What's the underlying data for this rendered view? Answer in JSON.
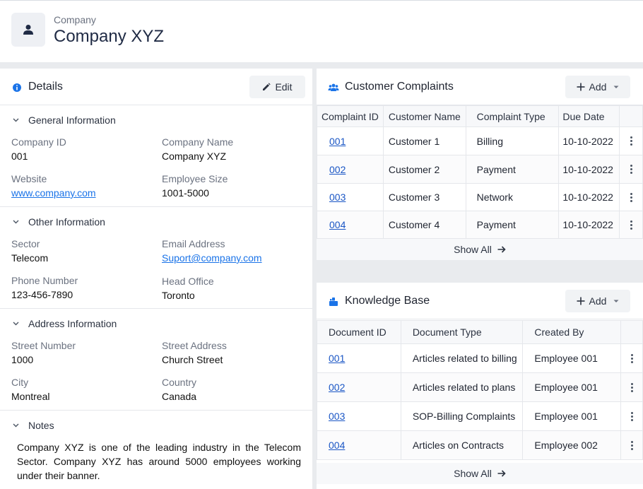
{
  "header": {
    "subtitle": "Company",
    "title": "Company XYZ"
  },
  "details": {
    "title": "Details",
    "edit_label": "Edit",
    "sections": {
      "general": {
        "title": "General Information",
        "company_id_label": "Company ID",
        "company_id": "001",
        "company_name_label": "Company Name",
        "company_name": "Company XYZ",
        "website_label": "Website",
        "website": "www.company.com",
        "employee_size_label": "Employee Size",
        "employee_size": "1001-5000"
      },
      "other": {
        "title": "Other Information",
        "sector_label": "Sector",
        "sector": "Telecom",
        "email_label": "Email Address",
        "email": "Suport@company.com",
        "phone_label": "Phone Number",
        "phone": "123-456-7890",
        "head_office_label": "Head Office",
        "head_office": "Toronto"
      },
      "address": {
        "title": "Address Information",
        "street_number_label": "Street Number",
        "street_number": "1000",
        "street_address_label": "Street Address",
        "street_address": "Church Street",
        "city_label": "City",
        "city": "Montreal",
        "country_label": "Country",
        "country": "Canada"
      },
      "notes": {
        "title": "Notes",
        "text": "Company XYZ is one of the leading industry in the Telecom Sector. Company XYZ has around 5000 employees working under their banner."
      }
    }
  },
  "complaints": {
    "title": "Customer Complaints",
    "add_label": "Add",
    "columns": [
      "Complaint ID",
      "Customer Name",
      "Complaint Type",
      "Due Date"
    ],
    "rows": [
      {
        "id": "001",
        "customer": "Customer 1",
        "type": "Billing",
        "due": "10-10-2022"
      },
      {
        "id": "002",
        "customer": "Customer 2",
        "type": "Payment",
        "due": "10-10-2022"
      },
      {
        "id": "003",
        "customer": "Customer 3",
        "type": "Network",
        "due": "10-10-2022"
      },
      {
        "id": "004",
        "customer": "Customer 4",
        "type": "Payment",
        "due": "10-10-2022"
      }
    ],
    "show_all": "Show All"
  },
  "kb": {
    "title": "Knowledge Base",
    "add_label": "Add",
    "columns": [
      "Document ID",
      "Document Type",
      "Created By"
    ],
    "rows": [
      {
        "id": "001",
        "type": "Articles related to billing",
        "created_by": "Employee 001"
      },
      {
        "id": "002",
        "type": "Articles related to plans",
        "created_by": "Employee 001"
      },
      {
        "id": "003",
        "type": "SOP-Billing Complaints",
        "created_by": "Employee 001"
      },
      {
        "id": "004",
        "type": "Articles on Contracts",
        "created_by": "Employee 002"
      }
    ],
    "show_all": "Show All"
  },
  "colors": {
    "accent": "#1a73e8",
    "link": "#1a56c5",
    "bg": "#e9ebee"
  }
}
